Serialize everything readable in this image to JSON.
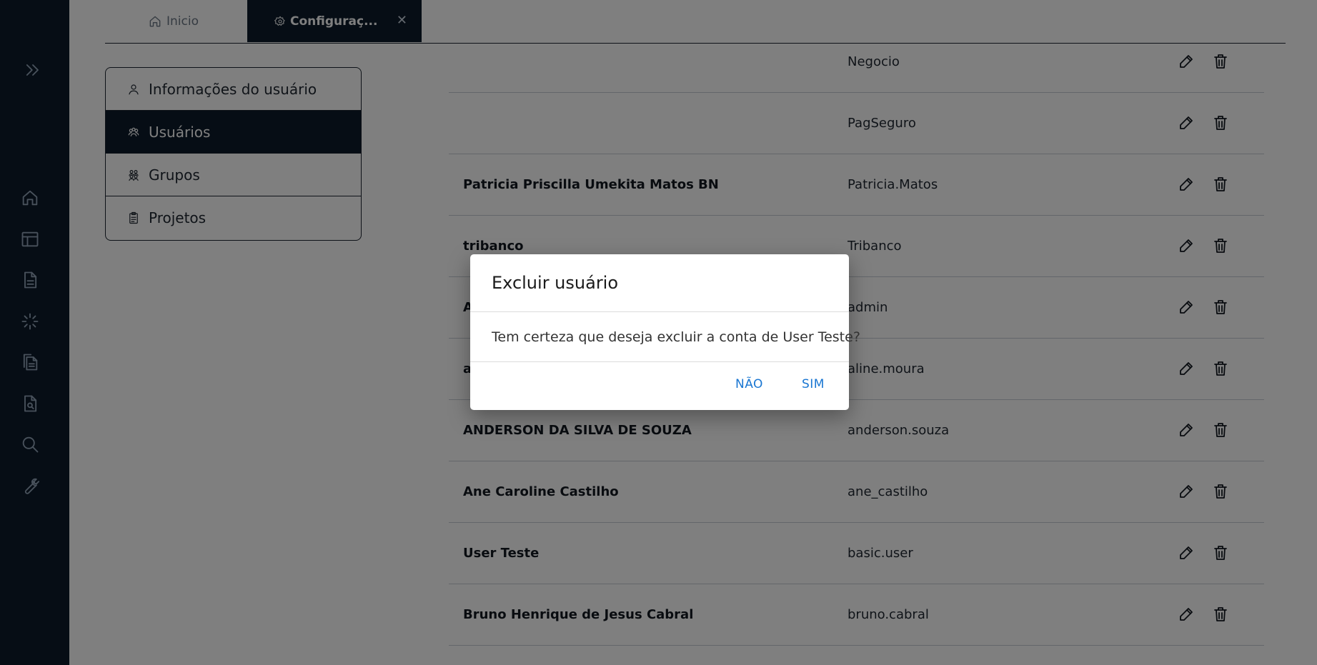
{
  "sidebar": {
    "icons": [
      "expand-icon",
      "home-icon",
      "layout-icon",
      "document-icon",
      "loader-icon",
      "files-icon",
      "file-search-icon",
      "search-icon",
      "wrench-icon"
    ]
  },
  "tabs": [
    {
      "label": "Inicio",
      "icon": "home-icon"
    },
    {
      "label": "Configuraç...",
      "icon": "gear-icon",
      "close": "✕"
    }
  ],
  "settings_menu": {
    "items": [
      {
        "label": "Informações do usuário",
        "icon": "user-icon"
      },
      {
        "label": "Usuários",
        "icon": "users-icon",
        "active": true
      },
      {
        "label": "Grupos",
        "icon": "groups-icon"
      },
      {
        "label": "Projetos",
        "icon": "clipboard-icon"
      }
    ]
  },
  "users": [
    {
      "name": "",
      "login": "Negocio"
    },
    {
      "name": "",
      "login": "PagSeguro"
    },
    {
      "name": "Patricia Priscilla Umekita Matos BN",
      "login": "Patricia.Matos"
    },
    {
      "name": "tribanco",
      "login": "Tribanco"
    },
    {
      "name": "A",
      "login": "admin"
    },
    {
      "name": "a",
      "login": "aline.moura"
    },
    {
      "name": "ANDERSON DA SILVA DE SOUZA",
      "login": "anderson.souza"
    },
    {
      "name": "Ane Caroline Castilho",
      "login": "ane_castilho"
    },
    {
      "name": "User Teste",
      "login": "basic.user"
    },
    {
      "name": "Bruno Henrique de Jesus Cabral",
      "login": "bruno.cabral"
    }
  ],
  "dialog": {
    "title": "Excluir usuário",
    "message": "Tem certeza que deseja excluir a conta de User Teste?",
    "cancel_label": "NÃO",
    "confirm_label": "SIM"
  },
  "colors": {
    "sidebar_bg": "#0c1b2b",
    "active_bg": "#0c1b2b",
    "dialog_button": "#1976d2"
  }
}
